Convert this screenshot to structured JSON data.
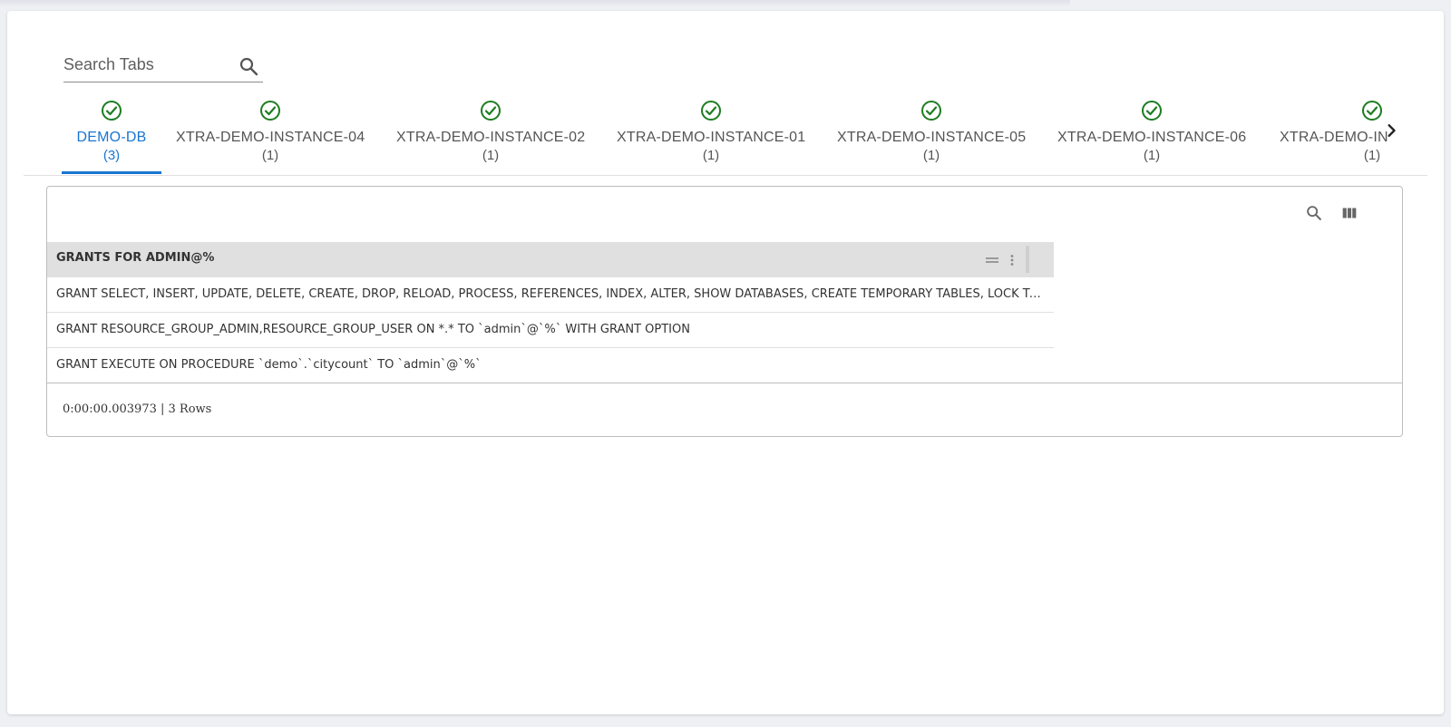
{
  "search": {
    "placeholder": "Search Tabs",
    "value": ""
  },
  "tabs": [
    {
      "name": "DEMO-DB",
      "count": "(3)",
      "active": true,
      "status_icon": "check-circle-icon"
    },
    {
      "name": "XTRA-DEMO-INSTANCE-04",
      "count": "(1)",
      "active": false,
      "status_icon": "check-circle-icon"
    },
    {
      "name": "XTRA-DEMO-INSTANCE-02",
      "count": "(1)",
      "active": false,
      "status_icon": "check-circle-icon"
    },
    {
      "name": "XTRA-DEMO-INSTANCE-01",
      "count": "(1)",
      "active": false,
      "status_icon": "check-circle-icon"
    },
    {
      "name": "XTRA-DEMO-INSTANCE-05",
      "count": "(1)",
      "active": false,
      "status_icon": "check-circle-icon"
    },
    {
      "name": "XTRA-DEMO-INSTANCE-06",
      "count": "(1)",
      "active": false,
      "status_icon": "check-circle-icon"
    },
    {
      "name": "XTRA-DEMO-IN",
      "count": "(1)",
      "active": false,
      "status_icon": "check-circle-icon"
    }
  ],
  "table": {
    "column_header": "GRANTS FOR ADMIN@%",
    "rows": [
      "GRANT SELECT, INSERT, UPDATE, DELETE, CREATE, DROP, RELOAD, PROCESS, REFERENCES, INDEX, ALTER, SHOW DATABASES, CREATE TEMPORARY TABLES, LOCK TABLES,...",
      "GRANT RESOURCE_GROUP_ADMIN,RESOURCE_GROUP_USER ON *.* TO `admin`@`%` WITH GRANT OPTION",
      "GRANT EXECUTE ON PROCEDURE `demo`.`citycount` TO `admin`@`%`"
    ]
  },
  "footer": {
    "status": "0:00:00.003973 | 3 Rows"
  },
  "colors": {
    "accent": "#1976d2",
    "success": "#1e7d22",
    "header_bg": "#e0e0e0"
  }
}
